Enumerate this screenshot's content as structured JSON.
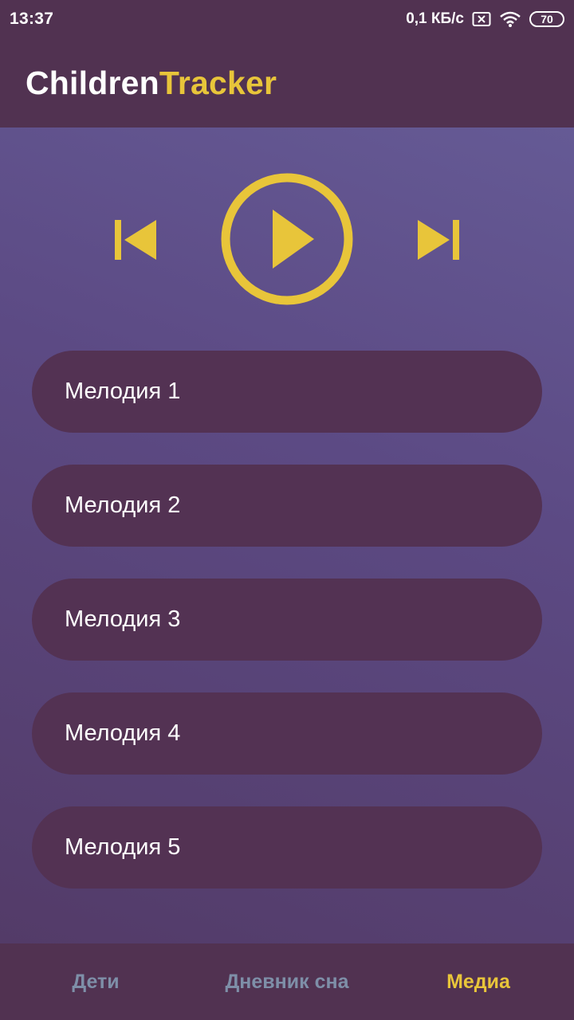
{
  "status_bar": {
    "time": "13:37",
    "speed": "0,1 КБ/с",
    "battery": "70"
  },
  "app": {
    "title_part1": "Children",
    "title_part2": "Tracker"
  },
  "colors": {
    "accent": "#e8c53a",
    "panel": "#533253",
    "nav_inactive": "#7e8fa8"
  },
  "player": {
    "prev_icon": "skip-previous-icon",
    "play_icon": "play-circle-icon",
    "next_icon": "skip-next-icon"
  },
  "tracks": [
    {
      "label": "Мелодия 1"
    },
    {
      "label": "Мелодия 2"
    },
    {
      "label": "Мелодия 3"
    },
    {
      "label": "Мелодия 4"
    },
    {
      "label": "Мелодия 5"
    }
  ],
  "nav": {
    "items": [
      {
        "label": "Дети",
        "active": false
      },
      {
        "label": "Дневник сна",
        "active": false
      },
      {
        "label": "Медиа",
        "active": true
      }
    ]
  }
}
